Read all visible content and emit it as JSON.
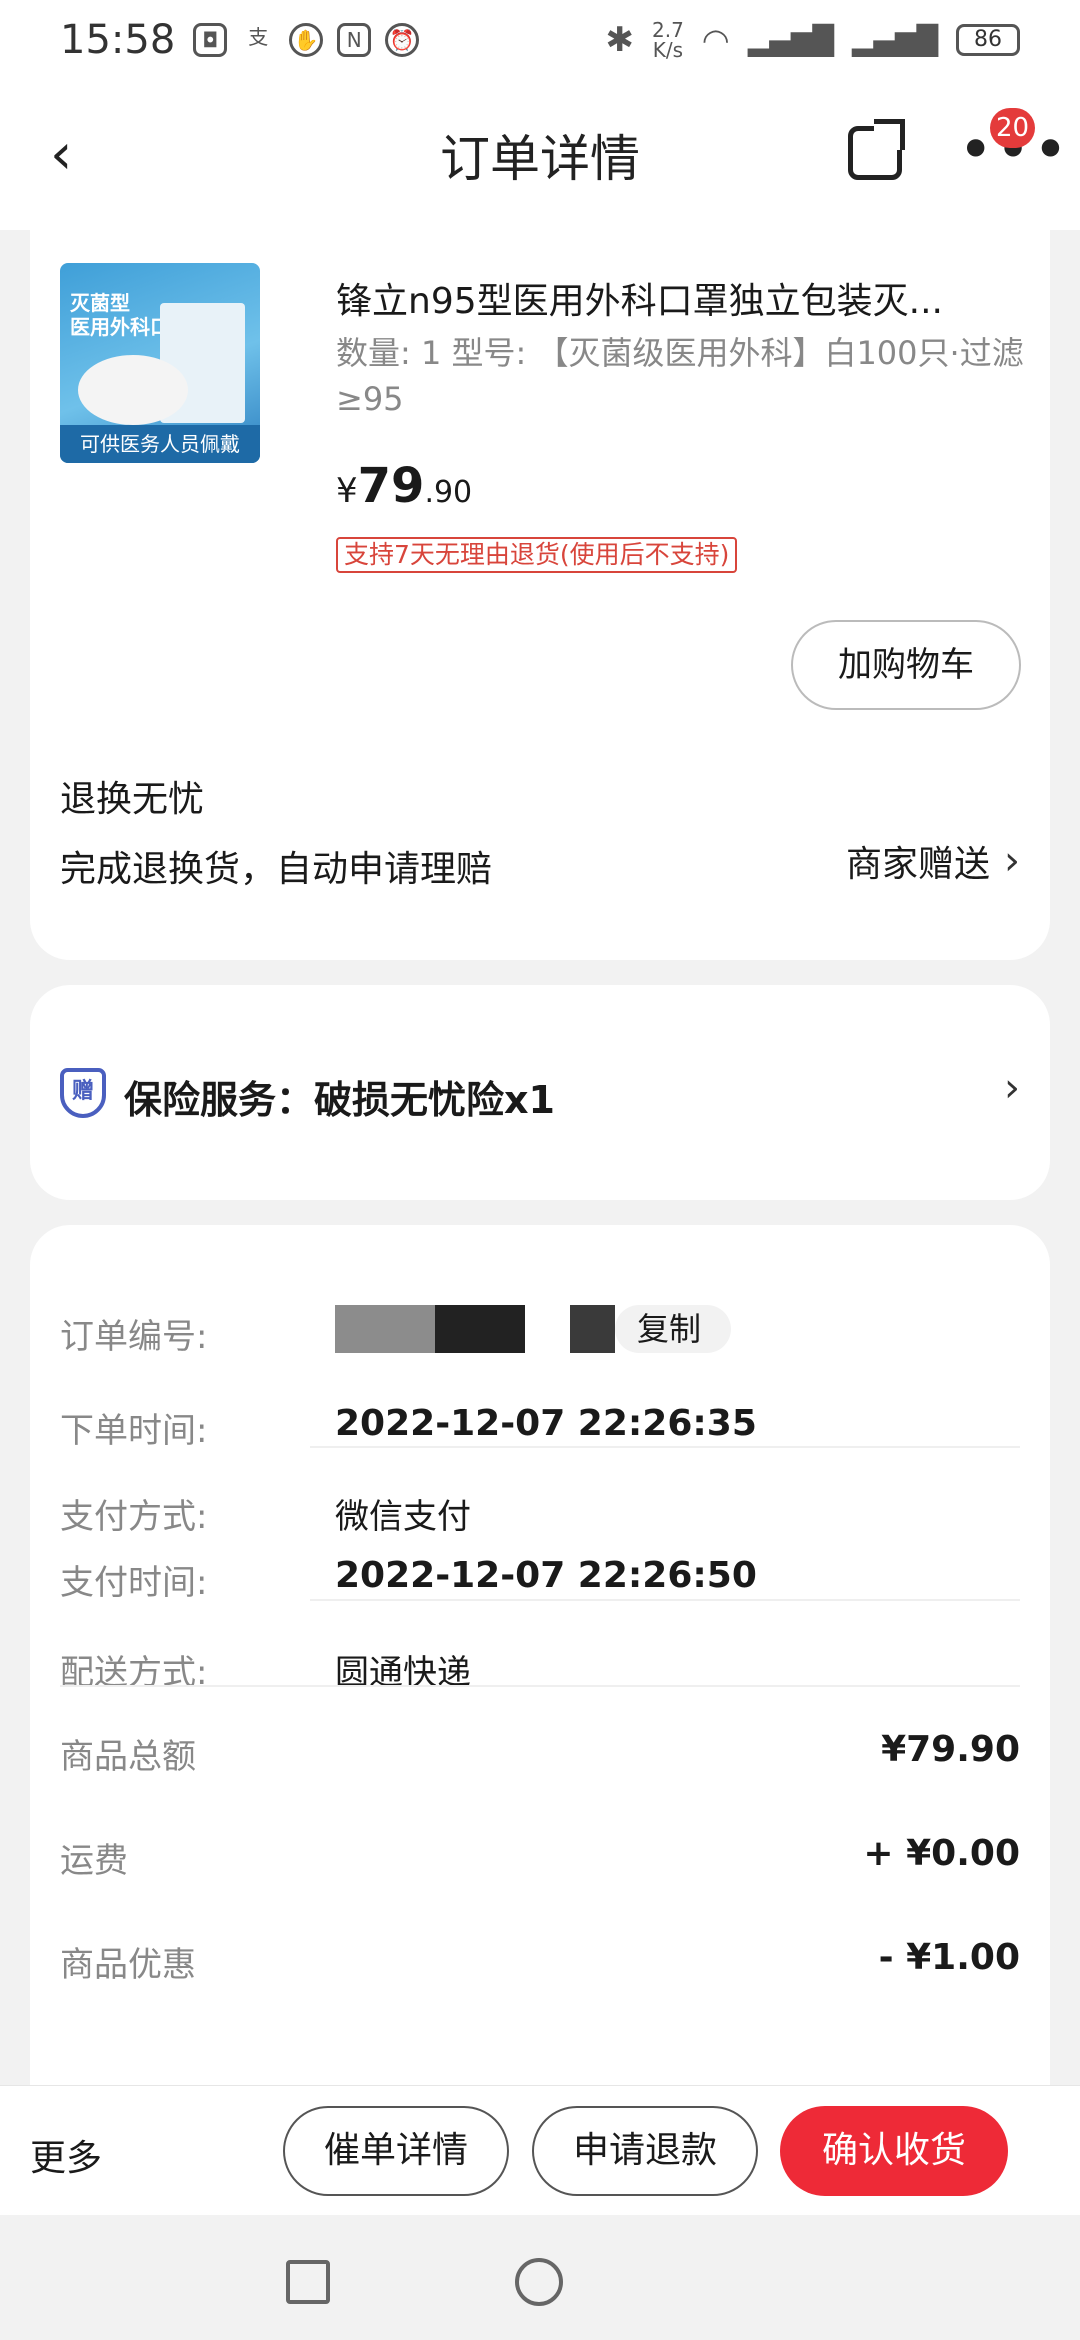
{
  "status_bar": {
    "time": "15:58",
    "net_speed": "2.7\nK/s",
    "battery": "86",
    "icons": [
      "app-icon",
      "alipay-icon",
      "hand-icon",
      "nfc-icon",
      "alarm-icon",
      "bluetooth-icon",
      "wifi-icon",
      "signal-4g-icon",
      "signal-5g-icon"
    ]
  },
  "header": {
    "title": "订单详情",
    "back_icon": "‹",
    "more_icon": "•••",
    "badge": "20"
  },
  "product": {
    "thumb_text": "灭菌型\n医用外科口罩",
    "thumb_footer": "可供医务人员佩戴",
    "title": "锋立n95型医用外科口罩独立包装灭...",
    "spec": "数量: 1   型号: 【灭菌级医用外科】白100只·过滤≥95",
    "price_currency": "¥",
    "price_int": "79",
    "price_dec": ".90",
    "return_tag": "支持7天无理由退货(使用后不支持)",
    "add_cart": "加购物车"
  },
  "worry_free": {
    "title": "退换无忧",
    "desc": "完成退换货，自动申请理赔",
    "right_label": "商家赠送"
  },
  "insurance": {
    "icon_text": "赠",
    "text": "保险服务：破损无忧险x1"
  },
  "order": {
    "order_no_label": "订单编号:",
    "copy_label": "复制",
    "order_time_label": "下单时间:",
    "order_time": "2022-12-07 22:26:35",
    "pay_method_label": "支付方式:",
    "pay_method": "微信支付",
    "pay_time_label": "支付时间:",
    "pay_time": "2022-12-07 22:26:50",
    "delivery_label": "配送方式:",
    "delivery": "圆通快递",
    "subtotal_label": "商品总额",
    "subtotal": "¥79.90",
    "shipping_label": "运费",
    "shipping": "+ ¥0.00",
    "discount_label": "商品优惠",
    "discount": "- ¥1.00"
  },
  "bottom_bar": {
    "more": "更多",
    "btn_urge": "催单详情",
    "btn_refund": "申请退款",
    "btn_confirm": "确认收货"
  },
  "colors": {
    "accent_red": "#ee2a37",
    "tag_red": "#d8453b",
    "insurance_blue": "#4a5fbf"
  }
}
